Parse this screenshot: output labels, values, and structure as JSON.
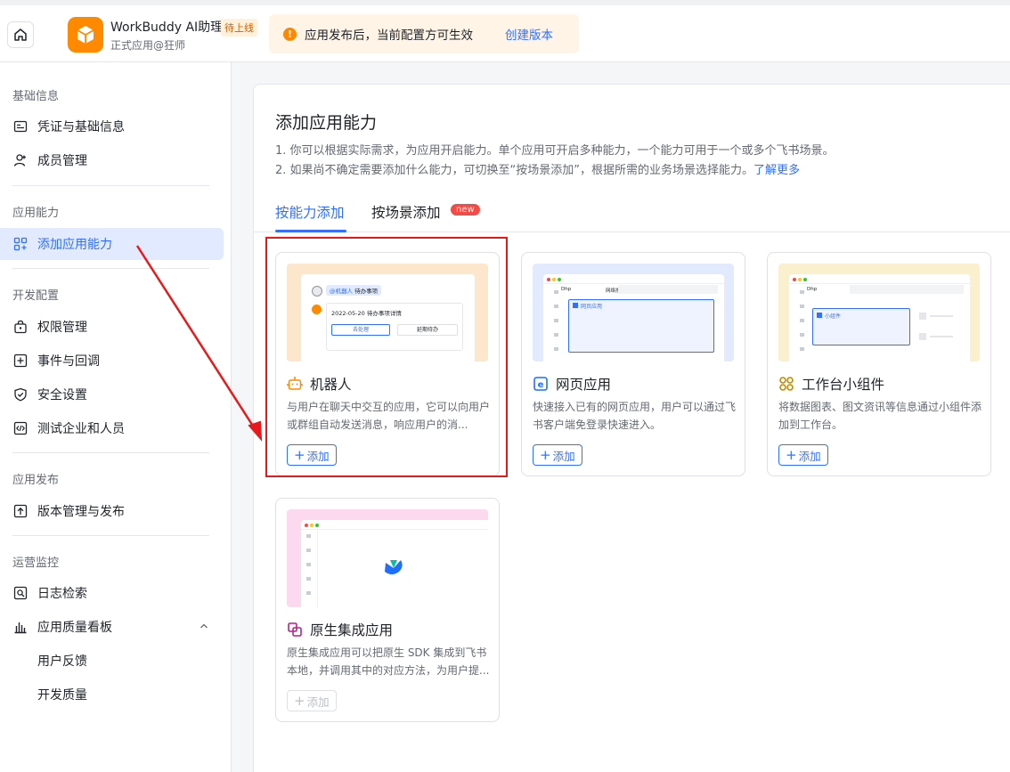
{
  "topbar": {
    "app_name": "WorkBuddy AI助理",
    "app_badge": "待上线",
    "app_subtitle": "正式应用@狂师",
    "notice_text": "应用发布后，当前配置方可生效",
    "notice_link": "创建版本",
    "notice_icon": "!"
  },
  "sidebar": {
    "sections": [
      {
        "title": "基础信息"
      },
      {
        "title": "应用能力"
      },
      {
        "title": "开发配置"
      },
      {
        "title": "应用发布"
      },
      {
        "title": "运营监控"
      }
    ],
    "items": [
      {
        "label": "凭证与基础信息",
        "icon": "credential-icon"
      },
      {
        "label": "成员管理",
        "icon": "member-icon"
      },
      {
        "label": "添加应用能力",
        "icon": "add-grid-icon",
        "active": true
      },
      {
        "label": "权限管理",
        "icon": "lock-bag-icon"
      },
      {
        "label": "事件与回调",
        "icon": "event-icon"
      },
      {
        "label": "安全设置",
        "icon": "shield-icon"
      },
      {
        "label": "测试企业和人员",
        "icon": "code-icon"
      },
      {
        "label": "版本管理与发布",
        "icon": "upload-icon"
      },
      {
        "label": "日志检索",
        "icon": "log-search-icon"
      },
      {
        "label": "应用质量看板",
        "icon": "bar-chart-icon"
      },
      {
        "label": "用户反馈"
      },
      {
        "label": "开发质量"
      }
    ]
  },
  "main": {
    "title": "添加应用能力",
    "desc_line1": "1. 你可以根据实际需求，为应用开启能力。单个应用可开启多种能力，一个能力可用于一个或多个飞书场景。",
    "desc_line2": "2. 如果尚不确定需要添加什么能力，可切换至“按场景添加”，根据所需的业务场景选择能力。",
    "desc_link": "了解更多",
    "tabs": [
      {
        "label": "按能力添加",
        "active": true
      },
      {
        "label": "按场景添加",
        "badge": "new"
      }
    ],
    "cards": [
      {
        "title": "机器人",
        "icon": "robot-icon",
        "desc": "与用户在聊天中交互的应用，它可以向用户或群组自动发送消息，响应用户的消...",
        "add_label": "添加",
        "preview": {
          "mention": "@机器人",
          "todo": "待办事项",
          "date_line": "2022-05-20 待办事项详情",
          "btn1": "去处理",
          "btn2": "延期待办"
        }
      },
      {
        "title": "网页应用",
        "icon": "web-e-icon",
        "desc": "快速接入已有的网页应用，用户可以通过飞书客户端免登录快速进入。",
        "add_label": "添加",
        "preview": {
          "tab1": "Dhp",
          "tab2": "网络搜",
          "panel": "网页应用"
        }
      },
      {
        "title": "工作台小组件",
        "icon": "widget-icon",
        "desc": "将数据图表、图文资讯等信息通过小组件添加到工作台。",
        "add_label": "添加",
        "preview": {
          "tab1": "Dhp",
          "panel": "小组件"
        }
      },
      {
        "title": "原生集成应用",
        "icon": "native-icon",
        "desc": "原生集成应用可以把原生 SDK 集成到飞书本地，并调用其中的对应方法，为用户提...",
        "add_label": "添加",
        "disabled": true
      }
    ]
  },
  "colors": {
    "accent": "#3370ff",
    "highlight": "#e8191a",
    "orange": "#ff8a00"
  }
}
